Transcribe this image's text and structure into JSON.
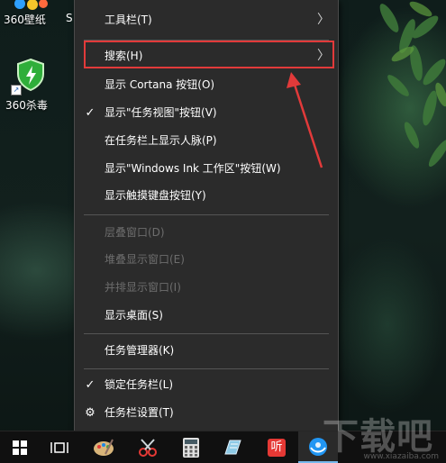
{
  "desktop": {
    "icons": [
      {
        "label": "360壁纸"
      },
      {
        "label": "360杀毒"
      }
    ],
    "partial_text": "S"
  },
  "context_menu": {
    "items": [
      {
        "label": "工具栏(T)",
        "has_submenu": true,
        "checked": false,
        "disabled": false
      },
      {
        "label": "搜索(H)",
        "has_submenu": true,
        "checked": false,
        "disabled": false,
        "highlighted": true
      },
      {
        "label": "显示 Cortana 按钮(O)",
        "has_submenu": false,
        "checked": false,
        "disabled": false
      },
      {
        "label": "显示\"任务视图\"按钮(V)",
        "has_submenu": false,
        "checked": true,
        "disabled": false
      },
      {
        "label": "在任务栏上显示人脉(P)",
        "has_submenu": false,
        "checked": false,
        "disabled": false
      },
      {
        "label": "显示\"Windows Ink 工作区\"按钮(W)",
        "has_submenu": false,
        "checked": false,
        "disabled": false
      },
      {
        "label": "显示触摸键盘按钮(Y)",
        "has_submenu": false,
        "checked": false,
        "disabled": false
      },
      {
        "label": "层叠窗口(D)",
        "has_submenu": false,
        "checked": false,
        "disabled": true
      },
      {
        "label": "堆叠显示窗口(E)",
        "has_submenu": false,
        "checked": false,
        "disabled": true
      },
      {
        "label": "并排显示窗口(I)",
        "has_submenu": false,
        "checked": false,
        "disabled": true
      },
      {
        "label": "显示桌面(S)",
        "has_submenu": false,
        "checked": false,
        "disabled": false
      },
      {
        "label": "任务管理器(K)",
        "has_submenu": false,
        "checked": false,
        "disabled": false
      },
      {
        "label": "锁定任务栏(L)",
        "has_submenu": false,
        "checked": true,
        "disabled": false
      },
      {
        "label": "任务栏设置(T)",
        "has_submenu": false,
        "checked": false,
        "disabled": false,
        "icon": "gear-icon"
      }
    ],
    "check_glyph": "✓",
    "chevron_glyph": "〉",
    "gear_glyph": "⚙",
    "highlight_color": "#e23a3a"
  },
  "taskbar": {
    "buttons": [
      {
        "icon": "windows-start-icon"
      },
      {
        "icon": "task-view-icon"
      },
      {
        "icon": "paint-palette-icon"
      },
      {
        "icon": "snipping-tool-icon"
      },
      {
        "icon": "calculator-icon"
      },
      {
        "icon": "notepad-icon"
      },
      {
        "icon": "app-red-icon",
        "text": "听"
      },
      {
        "icon": "browser-icon"
      }
    ]
  },
  "watermark": {
    "text": "下载吧",
    "url": "www.xiazaiba.com"
  }
}
